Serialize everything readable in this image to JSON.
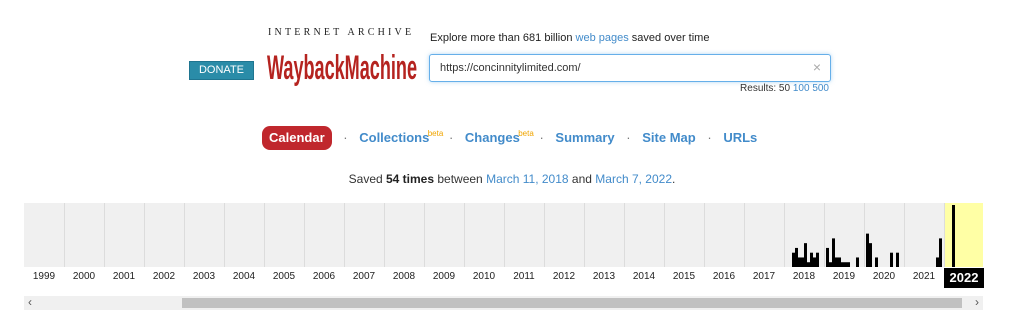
{
  "header": {
    "donate_label": "DONATE",
    "logo_top": "INTERNET ARCHIVE",
    "logo_text": "WaybackMachine",
    "explore_prefix": "Explore more than 681 billion ",
    "explore_link": "web pages",
    "explore_suffix": " saved over time",
    "url_value": "https://concinnitylimited.com/",
    "clear_symbol": "×",
    "results_label": "Results: 50",
    "results_opt1": "100",
    "results_opt2": "500"
  },
  "nav": {
    "calendar": "Calendar",
    "collections": "Collections",
    "changes": "Changes",
    "summary": "Summary",
    "sitemap": "Site Map",
    "urls": "URLs",
    "beta": "beta",
    "sep": "·"
  },
  "saved": {
    "prefix": "Saved ",
    "count": "54 times",
    "between": " between ",
    "first": "March 11, 2018",
    "and": " and ",
    "last": "March 7, 2022",
    "end": "."
  },
  "timeline": {
    "years": [
      "1999",
      "2000",
      "2001",
      "2002",
      "2003",
      "2004",
      "2005",
      "2006",
      "2007",
      "2008",
      "2009",
      "2010",
      "2011",
      "2012",
      "2013",
      "2014",
      "2015",
      "2016",
      "2017",
      "2018",
      "2019",
      "2020",
      "2021",
      "2022"
    ],
    "current_year": "2022",
    "highlight_color": "#ffffa5",
    "captures_by_year": {
      "2018": [
        0,
        0,
        3,
        4,
        2,
        2,
        5,
        1,
        3,
        2,
        3,
        0
      ],
      "2019": [
        4,
        1,
        6,
        2,
        2,
        1,
        1,
        1,
        0,
        0,
        2,
        0
      ],
      "2020": [
        7,
        5,
        0,
        2,
        0,
        0,
        0,
        0,
        3,
        0,
        3,
        0
      ],
      "2021": [
        0,
        0,
        0,
        0,
        0,
        0,
        0,
        0,
        0,
        0,
        2,
        6
      ],
      "2022": [
        0,
        0,
        13,
        0,
        0,
        0,
        0,
        0,
        0,
        0,
        0,
        0
      ]
    }
  },
  "scroll": {
    "left_symbol": "‹",
    "right_symbol": "›"
  }
}
